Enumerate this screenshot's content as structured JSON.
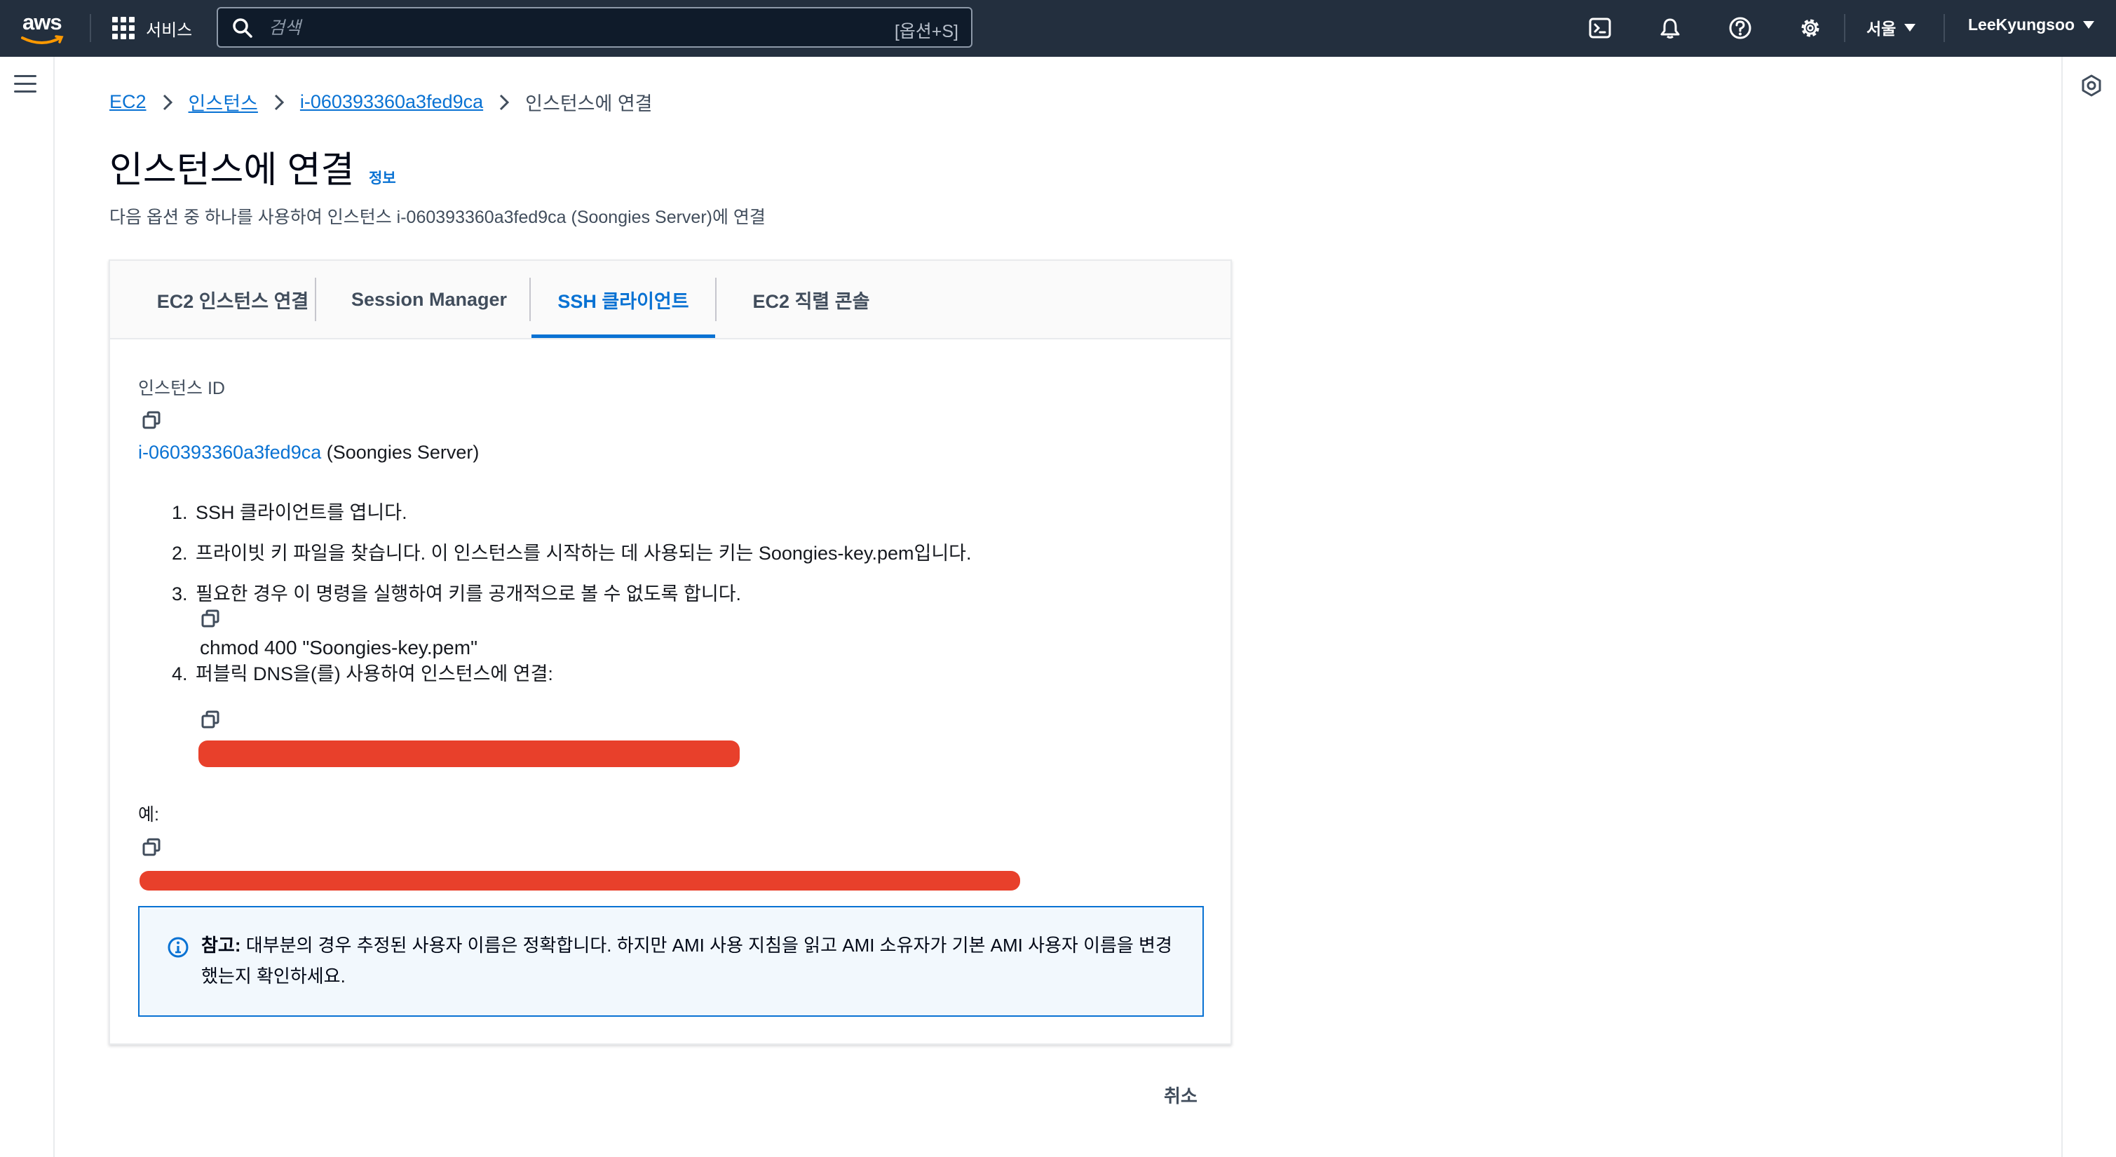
{
  "topnav": {
    "logo_text": "aws",
    "services_label": "서비스",
    "search_placeholder": "검색",
    "search_shortcut": "[옵션+S]",
    "region": "서울",
    "user": "LeeKyungsoo",
    "icons": [
      "cloudshell-icon",
      "bell-icon",
      "help-icon",
      "gear-icon"
    ]
  },
  "breadcrumb": {
    "items": [
      "EC2",
      "인스턴스",
      "i-060393360a3fed9ca"
    ],
    "current": "인스턴스에 연결"
  },
  "header": {
    "title": "인스턴스에 연결",
    "info": "정보",
    "subtitle": "다음 옵션 중 하나를 사용하여 인스턴스 i-060393360a3fed9ca (Soongies Server)에 연결"
  },
  "tabs": [
    {
      "label": "EC2 인스턴스 연결",
      "active": false
    },
    {
      "label": "Session Manager",
      "active": false
    },
    {
      "label": "SSH 클라이언트",
      "active": true
    },
    {
      "label": "EC2 직렬 콘솔",
      "active": false
    }
  ],
  "ssh": {
    "instance_id_label": "인스턴스 ID",
    "instance_id": "i-060393360a3fed9ca",
    "instance_name": "(Soongies Server)",
    "steps": [
      {
        "num": "1.",
        "text": "SSH 클라이언트를 엽니다."
      },
      {
        "num": "2.",
        "text": "프라이빗 키 파일을 찾습니다. 이 인스턴스를 시작하는 데 사용되는 키는 Soongies-key.pem입니다."
      },
      {
        "num": "3.",
        "text": "필요한 경우 이 명령을 실행하여 키를 공개적으로 볼 수 없도록 합니다."
      },
      {
        "num": "4.",
        "text": "퍼블릭 DNS을(를) 사용하여 인스턴스에 연결:"
      }
    ],
    "chmod_command": "chmod 400 \"Soongies-key.pem\"",
    "example_label": "예:"
  },
  "note": {
    "label": "참고:",
    "text": " 대부분의 경우 추정된 사용자 이름은 정확합니다. 하지만 AMI 사용 지침을 읽고 AMI 소유자가 기본 AMI 사용자 이름을 변경했는지 확인하세요."
  },
  "footer": {
    "cancel": "취소"
  },
  "colors": {
    "nav_bg": "#232f3e",
    "link": "#0972d3",
    "redaction": "#e8402b",
    "note_bg": "#f2f8fd"
  }
}
